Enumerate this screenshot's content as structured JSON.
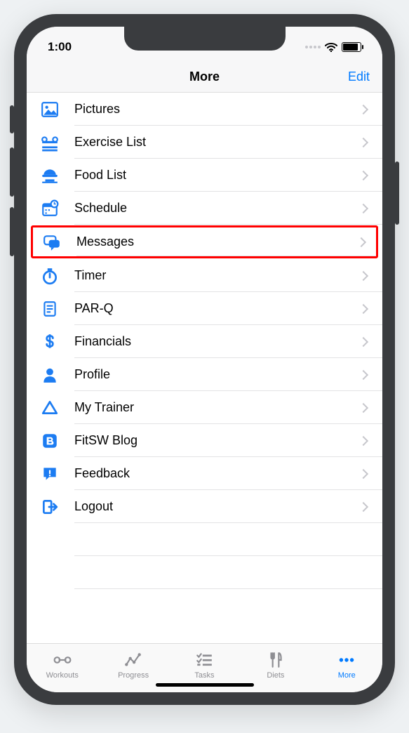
{
  "status": {
    "time": "1:00"
  },
  "nav": {
    "title": "More",
    "edit": "Edit"
  },
  "menu": {
    "items": [
      {
        "label": "Pictures",
        "icon": "picture-icon",
        "highlight": false
      },
      {
        "label": "Exercise List",
        "icon": "barbell-icon",
        "highlight": false
      },
      {
        "label": "Food List",
        "icon": "food-icon",
        "highlight": false
      },
      {
        "label": "Schedule",
        "icon": "calendar-icon",
        "highlight": false
      },
      {
        "label": "Messages",
        "icon": "messages-icon",
        "highlight": true
      },
      {
        "label": "Timer",
        "icon": "timer-icon",
        "highlight": false
      },
      {
        "label": "PAR-Q",
        "icon": "document-icon",
        "highlight": false
      },
      {
        "label": "Financials",
        "icon": "dollar-icon",
        "highlight": false
      },
      {
        "label": "Profile",
        "icon": "profile-icon",
        "highlight": false
      },
      {
        "label": "My Trainer",
        "icon": "trainer-icon",
        "highlight": false
      },
      {
        "label": "FitSW Blog",
        "icon": "blog-icon",
        "highlight": false
      },
      {
        "label": "Feedback",
        "icon": "feedback-icon",
        "highlight": false
      },
      {
        "label": "Logout",
        "icon": "logout-icon",
        "highlight": false
      }
    ]
  },
  "tabs": {
    "items": [
      {
        "label": "Workouts",
        "icon": "workouts-tab-icon",
        "active": false
      },
      {
        "label": "Progress",
        "icon": "progress-tab-icon",
        "active": false
      },
      {
        "label": "Tasks",
        "icon": "tasks-tab-icon",
        "active": false
      },
      {
        "label": "Diets",
        "icon": "diets-tab-icon",
        "active": false
      },
      {
        "label": "More",
        "icon": "more-tab-icon",
        "active": true
      }
    ]
  },
  "colors": {
    "accent": "#007aff",
    "iconBlue": "#1c7cf2"
  }
}
